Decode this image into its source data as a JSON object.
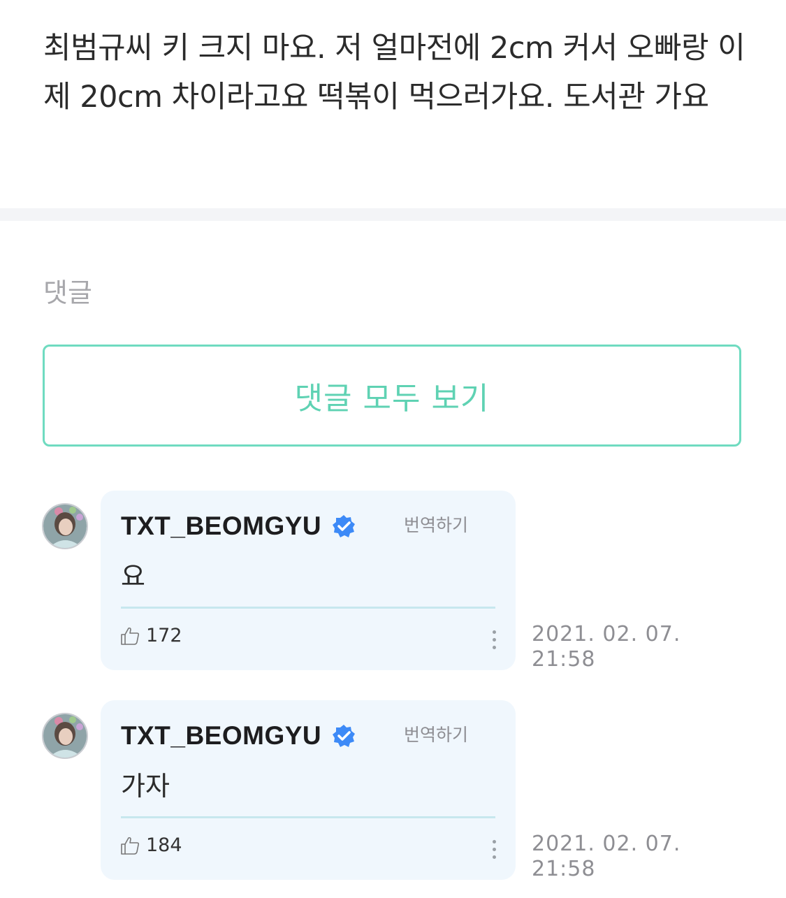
{
  "post": {
    "body": "최범규씨 키 크지 마요. 저 얼마전에 2cm 커서 오빠랑 이제 20cm 차이라고요 떡볶이 먹으러가요. 도서관 가요"
  },
  "comments_section": {
    "heading": "댓글",
    "view_all_label": "댓글 모두 보기"
  },
  "colors": {
    "accent": "#5fd2b3",
    "bubble_bg": "#f0f7fd",
    "verified_badge": "#3d8af7"
  },
  "comments": [
    {
      "author": "TXT_BEOMGYU",
      "verified": true,
      "translate_label": "번역하기",
      "text": "요",
      "likes": "172",
      "date": "2021. 02. 07.",
      "time": "21:58",
      "icons": [
        "avatar",
        "verified-badge-icon",
        "thumbs-up-icon",
        "more-options-icon"
      ]
    },
    {
      "author": "TXT_BEOMGYU",
      "verified": true,
      "translate_label": "번역하기",
      "text": "가자",
      "likes": "184",
      "date": "2021. 02. 07.",
      "time": "21:58",
      "icons": [
        "avatar",
        "verified-badge-icon",
        "thumbs-up-icon",
        "more-options-icon"
      ]
    }
  ]
}
